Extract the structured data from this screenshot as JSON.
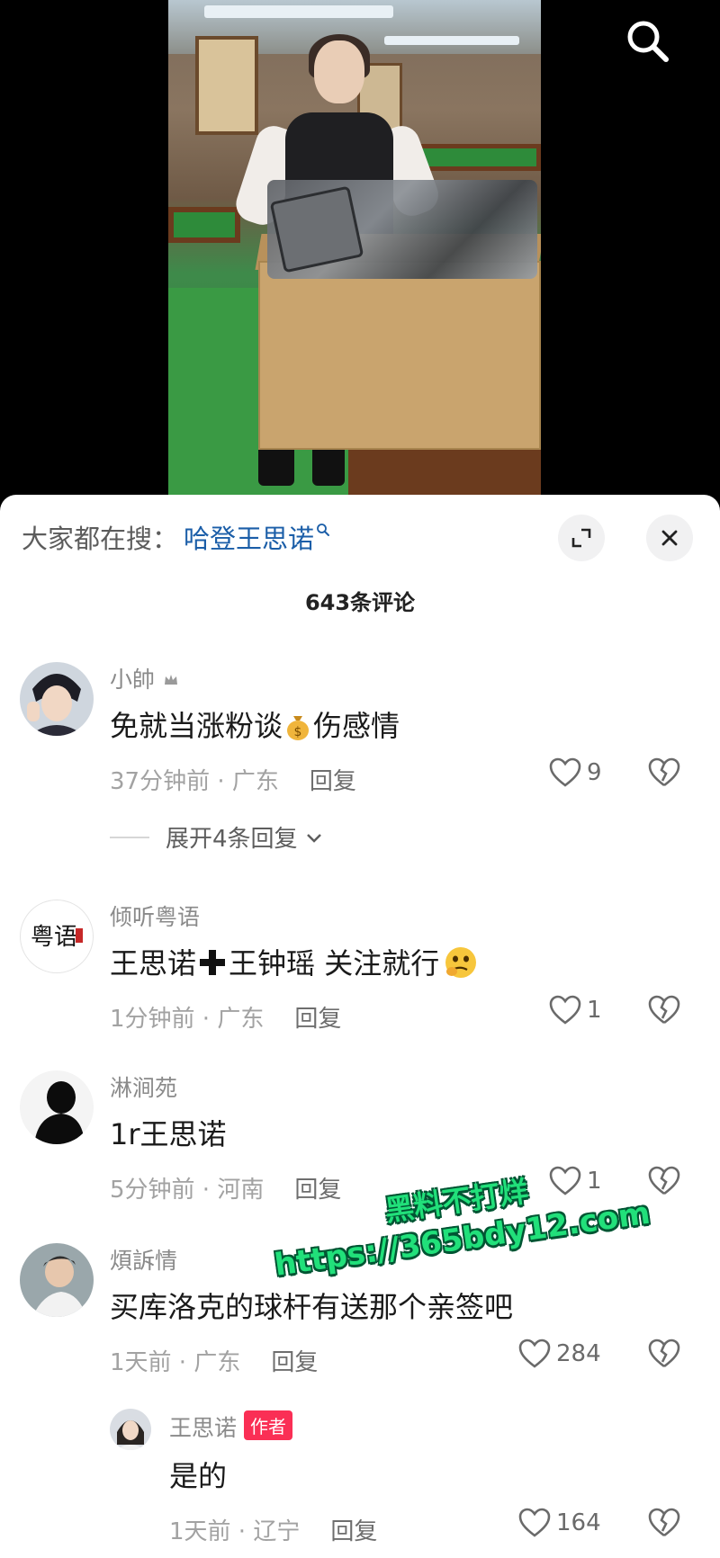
{
  "video": {
    "description_icon": "search-icon"
  },
  "search_bar": {
    "prefix": "大家都在搜：",
    "term": "哈登王思诺",
    "term_icon": "search-icon"
  },
  "comment_count": "643条评论",
  "comments": [
    {
      "user": "小帥",
      "user_badge": "crown-icon",
      "text": "免就当涨粉谈",
      "emoji": "money-bag-icon",
      "text_after": "伤感情",
      "time": "37分钟前 · 广东",
      "reply": "回复",
      "likes": "9",
      "expand": "展开4条回复"
    },
    {
      "user": "倾听粤语",
      "text": "王思诺",
      "emoji": "plus-icon",
      "text_after": "王钟瑶   关注就行",
      "emoji2": "thinking-face-icon",
      "time": "1分钟前 · 广东",
      "reply": "回复",
      "likes": "1"
    },
    {
      "user": "淋涧苑",
      "text": "1r王思诺",
      "time": "5分钟前 · 河南",
      "reply": "回复",
      "likes": "1"
    },
    {
      "user": "煩訴情",
      "text": "买库洛克的球杆有送那个亲签吧",
      "time": "1天前 · 广东",
      "reply": "回复",
      "likes": "284"
    }
  ],
  "sub_reply": {
    "user": "王思诺",
    "tag": "作者",
    "text": "是的",
    "time": "1天前 · 辽宁",
    "reply": "回复",
    "likes": "164"
  },
  "avatar_texts": {
    "yueyu": "粤语"
  },
  "watermark": {
    "line1": "黑料不打烊",
    "line2": "https://365bdy12.com"
  },
  "colors": {
    "accent_blue": "#1b5ea8",
    "author_tag": "#fa2f55",
    "watermark": "#21e07a"
  }
}
